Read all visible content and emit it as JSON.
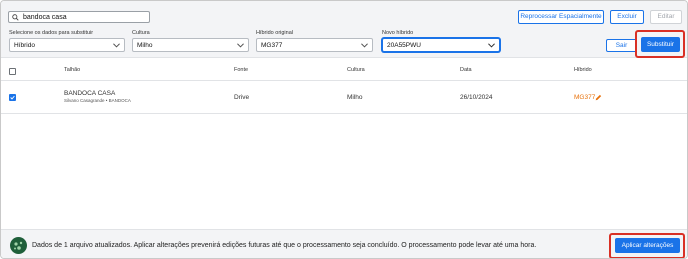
{
  "search": {
    "value": "bandoca casa"
  },
  "toolbar": {
    "reprocess_label": "Reprocessar Espacialmente",
    "delete_label": "Excluir",
    "edit_label": "Editar"
  },
  "filters": {
    "data_label": "Selecione os dados para substituir",
    "data_value": "Híbrido",
    "culture_label": "Cultura",
    "culture_value": "Milho",
    "original_label": "Híbrido original",
    "original_value": "MG377",
    "new_label": "Novo híbrido",
    "new_value": "20A55PWU"
  },
  "actions": {
    "exit_label": "Sair",
    "replace_label": "Substituir"
  },
  "table": {
    "columns": [
      "Talhão",
      "Fonte",
      "Cultura",
      "Data",
      "Híbrido"
    ],
    "rows": [
      {
        "field": "BANDOCA CASA",
        "field_sub": "Silvano Casagrande • BANDOCA",
        "source": "Drive",
        "culture": "Milho",
        "date": "26/10/2024",
        "hybrid": "MG377"
      }
    ]
  },
  "footer": {
    "message": "Dados de 1 arquivo atualizados. Aplicar alterações prevenirá edições futuras até que o processamento seja concluído. O processamento pode levar até uma hora.",
    "apply_label": "Aplicar alterações"
  },
  "colors": {
    "accent": "#1a73e8",
    "highlight": "#d93025",
    "hybrid": "#e8710a",
    "logo": "#1f5f3a"
  },
  "icons": [
    "search-icon",
    "chevron-down-icon",
    "pencil-icon",
    "logo-icon"
  ]
}
